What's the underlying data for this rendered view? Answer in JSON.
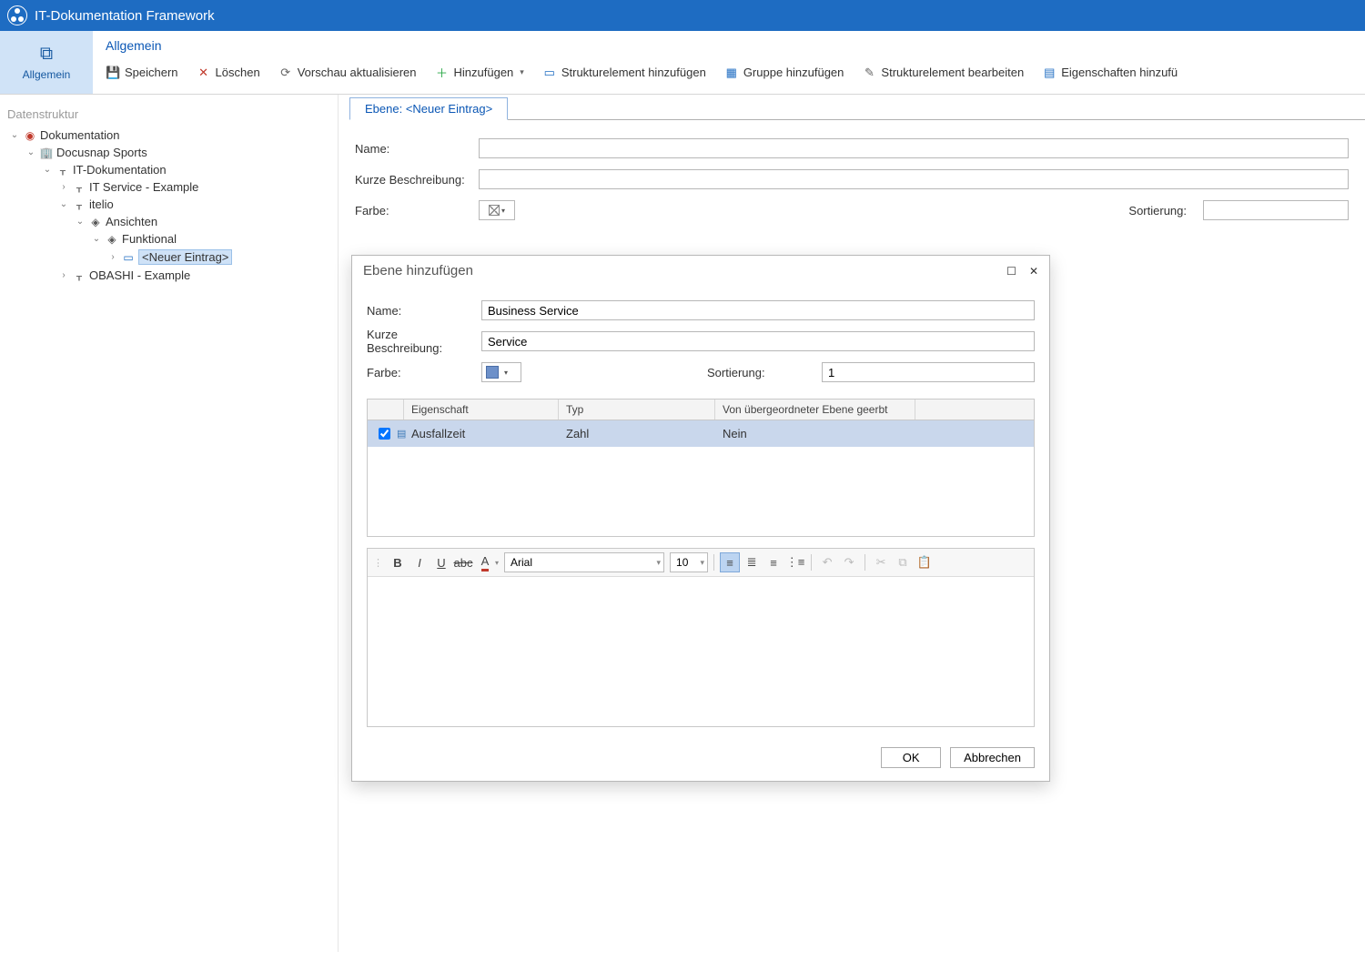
{
  "app": {
    "title": "IT-Dokumentation Framework"
  },
  "ribbon": {
    "side_tab": "Allgemein",
    "group_title": "Allgemein",
    "buttons": {
      "save": "Speichern",
      "delete": "Löschen",
      "refresh": "Vorschau aktualisieren",
      "add": "Hinzufügen",
      "add_struct": "Strukturelement hinzufügen",
      "add_group": "Gruppe hinzufügen",
      "edit_struct": "Strukturelement bearbeiten",
      "edit_props": "Eigenschaften hinzufü"
    }
  },
  "sidebar": {
    "title": "Datenstruktur",
    "tree": {
      "root": "Dokumentation",
      "company": "Docusnap Sports",
      "itdoc": "IT-Dokumentation",
      "svc_example": "IT Service - Example",
      "itelio": "itelio",
      "ansichten": "Ansichten",
      "funktional": "Funktional",
      "new_entry": "<Neuer Eintrag>",
      "obashi": "OBASHI - Example"
    }
  },
  "main_form": {
    "tab_label": "Ebene: <Neuer Eintrag>",
    "name_label": "Name:",
    "name_value": "",
    "desc_label": "Kurze Beschreibung:",
    "desc_value": "",
    "color_label": "Farbe:",
    "sort_label": "Sortierung:",
    "sort_value": ""
  },
  "dialog": {
    "title": "Ebene hinzufügen",
    "name_label": "Name:",
    "name_value": "Business Service",
    "desc_label": "Kurze Beschreibung:",
    "desc_value": "Service",
    "color_label": "Farbe:",
    "color_value": "#6d90c9",
    "sort_label": "Sortierung:",
    "sort_value": "1",
    "table": {
      "h_prop": "Eigenschaft",
      "h_type": "Typ",
      "h_inherited": "Von übergeordneter Ebene geerbt",
      "row1": {
        "checked": true,
        "prop": "Ausfallzeit",
        "type": "Zahl",
        "inherited": "Nein"
      }
    },
    "rte": {
      "font": "Arial",
      "size": "10"
    },
    "ok": "OK",
    "cancel": "Abbrechen"
  }
}
